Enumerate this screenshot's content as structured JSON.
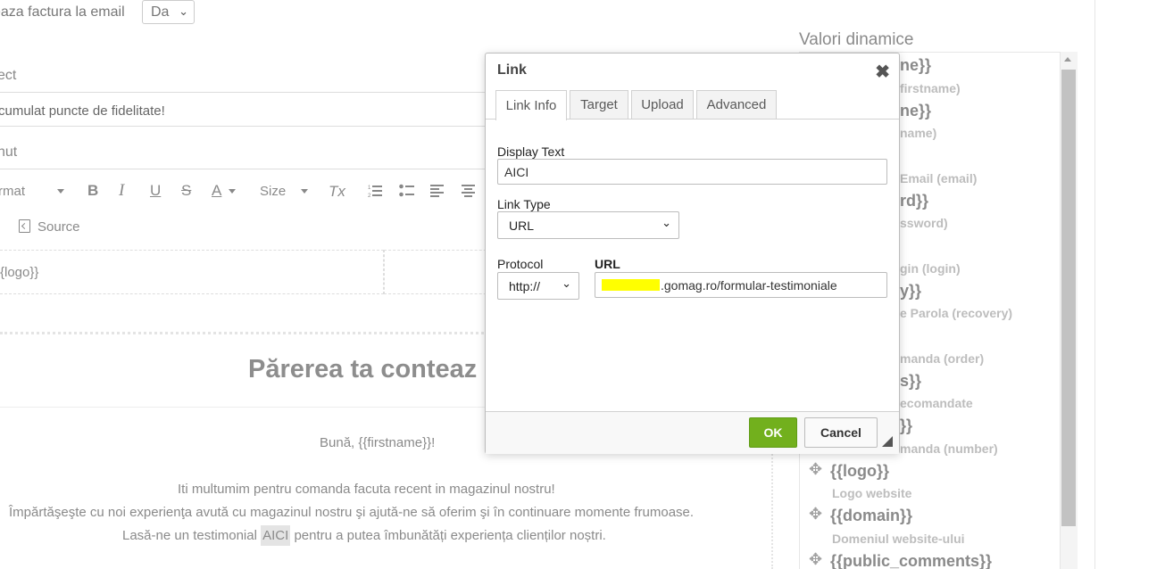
{
  "editor": {
    "email_label": "eaza factura la email",
    "email_value": "Da",
    "subject_label": "ect",
    "subject_value": "cumulat puncte de fidelitate!",
    "content_label": "nut",
    "toolbar": {
      "format_label": "rmat",
      "bold": "B",
      "italic": "I",
      "underline": "U",
      "strike": "S",
      "font_color": "A",
      "size_label": "Size",
      "clear_format": "Tx",
      "source_label": "Source"
    },
    "logo_placeholder": "{logo}}",
    "headline": "Părerea ta conteaz",
    "greeting": "Bună, {{firstname}}!",
    "line1": "Iti multumim pentru comanda facuta recent in magazinul nostru!",
    "line2": "Împărtăşeşte cu noi experienţa avută cu magazinul nostru şi ajută-ne să oferim şi în continuare momente frumoase.",
    "line3_before": "Lasă-ne un testimonial ",
    "line3_link": "AICI",
    "line3_after": " pentru a putea îmbunătăți experiența clienților noștri."
  },
  "dynamic_values": {
    "title": "Valori dinamice",
    "partial_items": [
      {
        "tag": "ne}}",
        "desc": "firstname)"
      },
      {
        "tag": "ne}}",
        "desc": "name)"
      },
      {
        "tag": "",
        "desc": "Email (email)"
      },
      {
        "tag": "rd}}",
        "desc": "ssword)"
      },
      {
        "tag": "",
        "desc": "gin (login)"
      },
      {
        "tag": "y}}",
        "desc": "e Parola (recovery)"
      },
      {
        "tag": "",
        "desc": "manda (order)"
      },
      {
        "tag": "s}}",
        "desc": "ecomandate"
      },
      {
        "tag": "}}",
        "desc": "manda (number)"
      }
    ],
    "items": [
      {
        "tag": "{{logo}}",
        "desc": "Logo website"
      },
      {
        "tag": "{{domain}}",
        "desc": "Domeniul website-ului"
      },
      {
        "tag": "{{public_comments}}",
        "desc": ""
      }
    ]
  },
  "link_dialog": {
    "title": "Link",
    "tabs": [
      "Link Info",
      "Target",
      "Upload",
      "Advanced"
    ],
    "active_tab": "Link Info",
    "display_text_label": "Display Text",
    "display_text_value": "AICI",
    "link_type_label": "Link Type",
    "link_type_value": "URL",
    "protocol_label": "Protocol",
    "protocol_value": "http://",
    "url_label": "URL",
    "url_value": ".gomag.ro/formular-testimoniale",
    "ok_label": "OK",
    "cancel_label": "Cancel"
  },
  "colors": {
    "ok_button": "#72b01d",
    "redaction": "#ffff00"
  }
}
